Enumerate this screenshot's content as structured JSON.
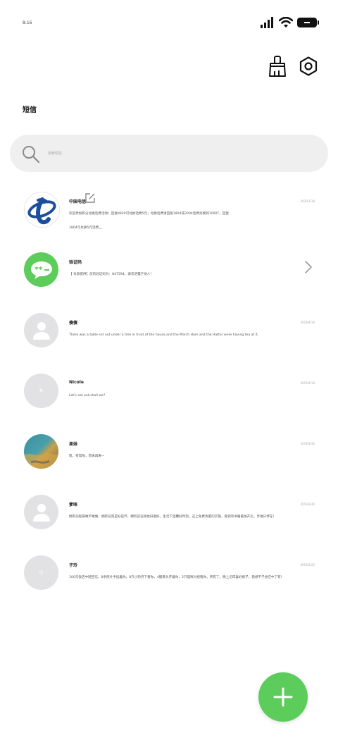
{
  "status_bar": {
    "time": "8:16"
  },
  "header": {
    "title": "短信"
  },
  "search": {
    "placeholder": "搜索短信"
  },
  "conversations": [
    {
      "name": "中国电信",
      "date": "2020/1/18",
      "preview": "欢迎参加积分兑换话费活动！回复8820可兑换话费5元；兑换话费请回复1804或2004话费兑换到1000T，回复",
      "preview2": "1804可兑换5元话费__",
      "avatar": "china-telecom-logo"
    },
    {
      "name": "验证码",
      "date": "",
      "preview": "【 号源提供】您的验证码为：847594，请勿泄露于他人！",
      "avatar": "sms-code-icon"
    },
    {
      "name": "傻傻",
      "date": "2019/4/10",
      "preview": "There was a table set out under a tree in front of the house,and the March Hare and the Hatter were having tea at it.",
      "avatar": "person-icon"
    },
    {
      "name": "Nicole",
      "date": "2019/4/10",
      "preview": "Let's eat out,shall we?",
      "avatar": "initial",
      "initial": "N"
    },
    {
      "name": "果妹",
      "date": "2019/3/30",
      "preview": "嗯，有帮啦，周末再来~",
      "avatar": "photo"
    },
    {
      "name": "爹咪",
      "date": "2019/3/30",
      "preview": "拥有前程属敢不敢做，拥有前景是好是坏，拥有前任钱依旧富好，生活下温馨好时刻，这上免费高量的实施，受到有书籍最加开怎，享福日伴在！",
      "avatar": "person-icon"
    },
    {
      "name": "子玲",
      "date": "2019/2/22",
      "preview": "100元饭店中随回信，8条照片手挂着你，8只小狗月下看你，4瓣黄头开着你，2只猫咪对视看你，所有了，晚上记得喜好被子，我想不子会在中了有！",
      "avatar": "initial",
      "initial": "玲"
    }
  ],
  "fab": {
    "icon": "plus-icon"
  },
  "colors": {
    "accent": "#5ccc5a",
    "telecom_blue": "#1d4e9e",
    "avatar_grey": "#e2e2e4",
    "search_bg": "#efefef"
  }
}
